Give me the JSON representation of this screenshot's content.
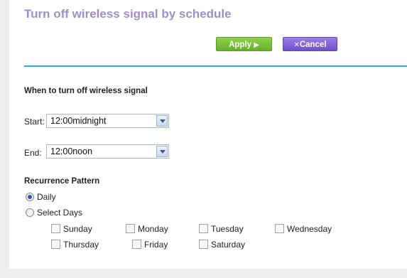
{
  "page": {
    "title": "Turn off wireless signal by schedule"
  },
  "actions": {
    "apply_label": "Apply",
    "apply_icon": "play-triangle",
    "cancel_label": "Cancel",
    "cancel_icon": "x-mark",
    "apply_color": "#72bf36",
    "cancel_color": "#7b5ed6"
  },
  "schedule": {
    "heading": "When to turn off wireless signal",
    "start_label": "Start:",
    "start_value": "12:00midnight",
    "end_label": "End:",
    "end_value": "12:00noon"
  },
  "recurrence": {
    "heading": "Recurrence Pattern",
    "options": [
      {
        "label": "Daily",
        "selected": true
      },
      {
        "label": "Select Days",
        "selected": false
      }
    ],
    "days": [
      {
        "label": "Sunday",
        "checked": false
      },
      {
        "label": "Monday",
        "checked": false
      },
      {
        "label": "Tuesday",
        "checked": false
      },
      {
        "label": "Wednesday",
        "checked": false
      },
      {
        "label": "Thursday",
        "checked": false
      },
      {
        "label": "Friday",
        "checked": false
      },
      {
        "label": "Saturday",
        "checked": false
      }
    ]
  },
  "colors": {
    "title": "#9c8fcb",
    "divider": "#2fa4dd"
  }
}
